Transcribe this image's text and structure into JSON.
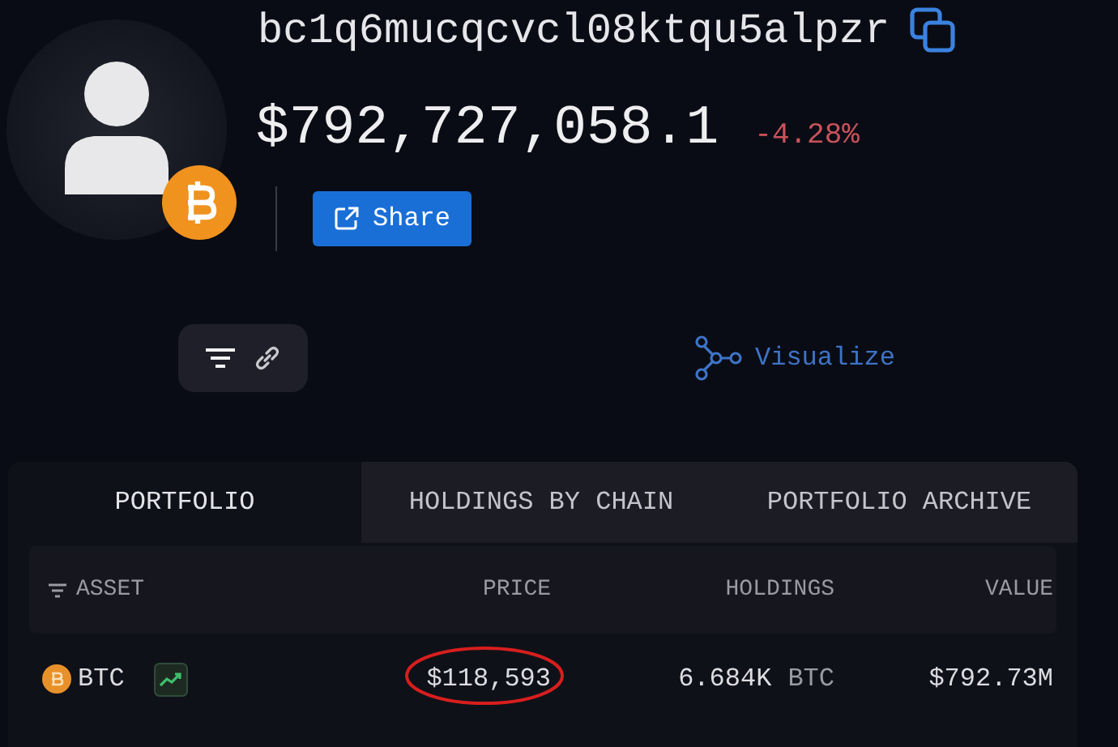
{
  "address": "bc1q6mucqcvcl08ktqu5alpzr",
  "balance": {
    "value": "$792,727,058.1",
    "change": "-4.28%"
  },
  "share_button": "Share",
  "visualize_link": "Visualize",
  "tabs": [
    {
      "label": "PORTFOLIO",
      "selected": true
    },
    {
      "label": "HOLDINGS BY CHAIN",
      "selected": false
    },
    {
      "label": "PORTFOLIO ARCHIVE",
      "selected": false
    }
  ],
  "table": {
    "columns": [
      "ASSET",
      "PRICE",
      "HOLDINGS",
      "VALUE"
    ],
    "rows": [
      {
        "asset": "BTC",
        "price": "$118,593",
        "price_circled": true,
        "holdings": "6.684K",
        "unit": "BTC",
        "value": "$792.73M"
      }
    ]
  }
}
